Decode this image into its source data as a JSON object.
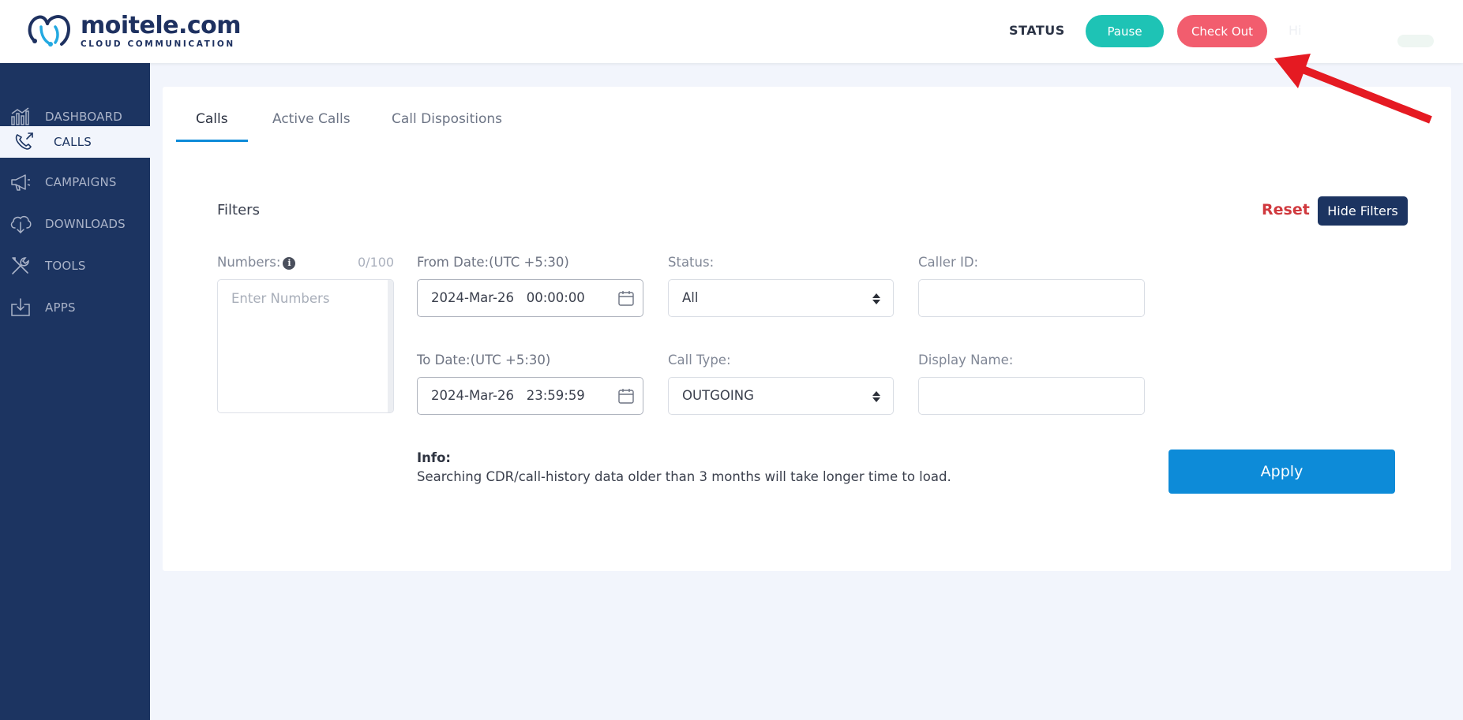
{
  "header": {
    "logo_text": "moitele.com",
    "logo_subtext": "CLOUD COMMUNICATION",
    "status_label": "STATUS",
    "pause_label": "Pause",
    "checkout_label": "Check Out",
    "faded_text": "Hi"
  },
  "sidebar": {
    "items": [
      {
        "label": "DASHBOARD",
        "icon": "dashboard-chart-icon"
      },
      {
        "label": "CALLS",
        "icon": "phone-call-icon",
        "active": true
      },
      {
        "label": "CAMPAIGNS",
        "icon": "megaphone-icon"
      },
      {
        "label": "DOWNLOADS",
        "icon": "cloud-download-icon"
      },
      {
        "label": "TOOLS",
        "icon": "tools-icon"
      },
      {
        "label": "APPS",
        "icon": "apps-download-icon"
      }
    ]
  },
  "tabs": [
    {
      "label": "Calls",
      "active": true
    },
    {
      "label": "Active Calls"
    },
    {
      "label": "Call Dispositions"
    }
  ],
  "filters": {
    "title": "Filters",
    "reset_label": "Reset",
    "hide_label": "Hide Filters",
    "numbers_label": "Numbers:",
    "numbers_counter": "0/100",
    "numbers_placeholder": "Enter Numbers",
    "from_label": "From Date:(UTC +5:30)",
    "from_value": "2024-Mar-26   00:00:00",
    "to_label": "To Date:(UTC +5:30)",
    "to_value": "2024-Mar-26   23:59:59",
    "status_label": "Status:",
    "status_value": "All",
    "calltype_label": "Call Type:",
    "calltype_value": "OUTGOING",
    "callerid_label": "Caller ID:",
    "callerid_value": "",
    "displayname_label": "Display Name:",
    "displayname_value": "",
    "info_head": "Info:",
    "info_text": "Searching CDR/call-history data older than 3 months will take longer time to load.",
    "apply_label": "Apply"
  },
  "colors": {
    "sidebar_bg": "#1c3461",
    "accent_blue": "#0d8bd8",
    "pause_teal": "#1ec3b5",
    "checkout_red": "#f25d6e",
    "reset_red": "#d0393e",
    "annotation_red": "#e51a22"
  }
}
